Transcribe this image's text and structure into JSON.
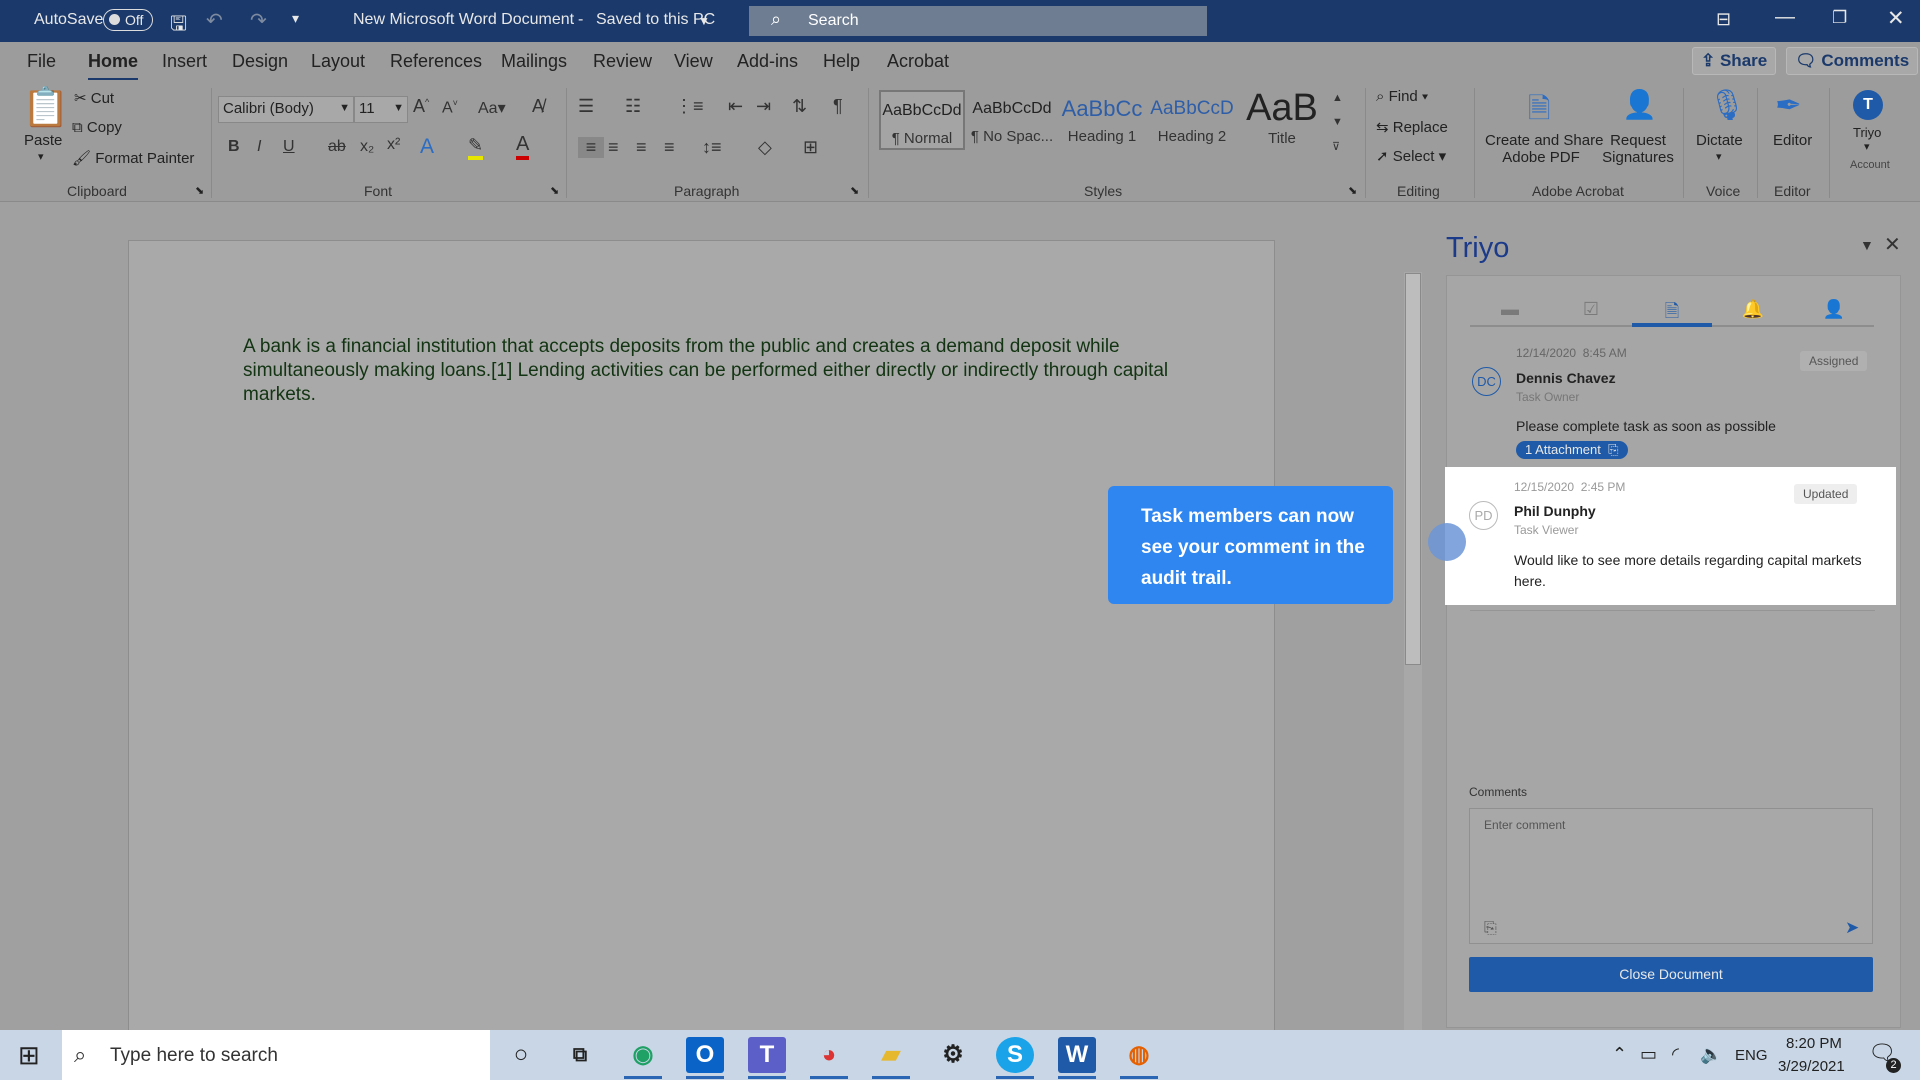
{
  "titlebar": {
    "autosave_label": "AutoSave",
    "autosave_state": "Off",
    "doc_title": "New Microsoft Word Document",
    "save_status": "Saved to this PC",
    "search_placeholder": "Search"
  },
  "tabs": [
    "File",
    "Home",
    "Insert",
    "Design",
    "Layout",
    "References",
    "Mailings",
    "Review",
    "View",
    "Add-ins",
    "Help",
    "Acrobat"
  ],
  "share_label": "Share",
  "comments_label": "Comments",
  "clipboard": {
    "paste": "Paste",
    "cut": "Cut",
    "copy": "Copy",
    "format_painter": "Format Painter",
    "group": "Clipboard"
  },
  "font": {
    "name": "Calibri (Body)",
    "size": "11",
    "group": "Font"
  },
  "paragraph": {
    "group": "Paragraph"
  },
  "styles": {
    "items": [
      {
        "preview": "AaBbCcDd",
        "name": "¶ Normal"
      },
      {
        "preview": "AaBbCcDd",
        "name": "¶ No Spac..."
      },
      {
        "preview": "AaBbCc",
        "name": "Heading 1"
      },
      {
        "preview": "AaBbCcD",
        "name": "Heading 2"
      },
      {
        "preview": "AaB",
        "name": "Title"
      }
    ],
    "group": "Styles"
  },
  "editing": {
    "find": "Find",
    "replace": "Replace",
    "select": "Select",
    "group": "Editing"
  },
  "acrobat": {
    "create": "Create and Share",
    "create2": "Adobe PDF",
    "request": "Request",
    "request2": "Signatures",
    "group": "Adobe Acrobat"
  },
  "voice": {
    "dictate": "Dictate",
    "group": "Voice"
  },
  "editor": {
    "label": "Editor",
    "group": "Editor"
  },
  "account": {
    "name": "Triyo",
    "label": "Account",
    "initial": "T"
  },
  "document": {
    "text": "A bank is a financial institution that accepts deposits from the public and creates a demand deposit while simultaneously making loans.[1] Lending activities can be performed either directly or indirectly through capital markets."
  },
  "callout": "Task members can now see your comment in the audit trail.",
  "pane": {
    "title": "Triyo",
    "entries": [
      {
        "date": "12/14/2020",
        "time": "8:45 AM",
        "initials": "DC",
        "name": "Dennis Chavez",
        "role": "Task Owner",
        "status": "Assigned",
        "message": "Please complete task as soon as possible",
        "attachment": "1 Attachment"
      },
      {
        "date": "12/15/2020",
        "time": "2:45 PM",
        "initials": "PD",
        "name": "Phil Dunphy",
        "role": "Task Viewer",
        "status": "Updated",
        "message": "Would like to see more details regarding capital markets here."
      }
    ],
    "comments_label": "Comments",
    "comment_placeholder": "Enter comment",
    "close_button": "Close Document"
  },
  "taskbar": {
    "search_placeholder": "Type here to search",
    "time": "8:20 PM",
    "date": "3/29/2021",
    "lang": "ENG",
    "notifications": "2"
  }
}
